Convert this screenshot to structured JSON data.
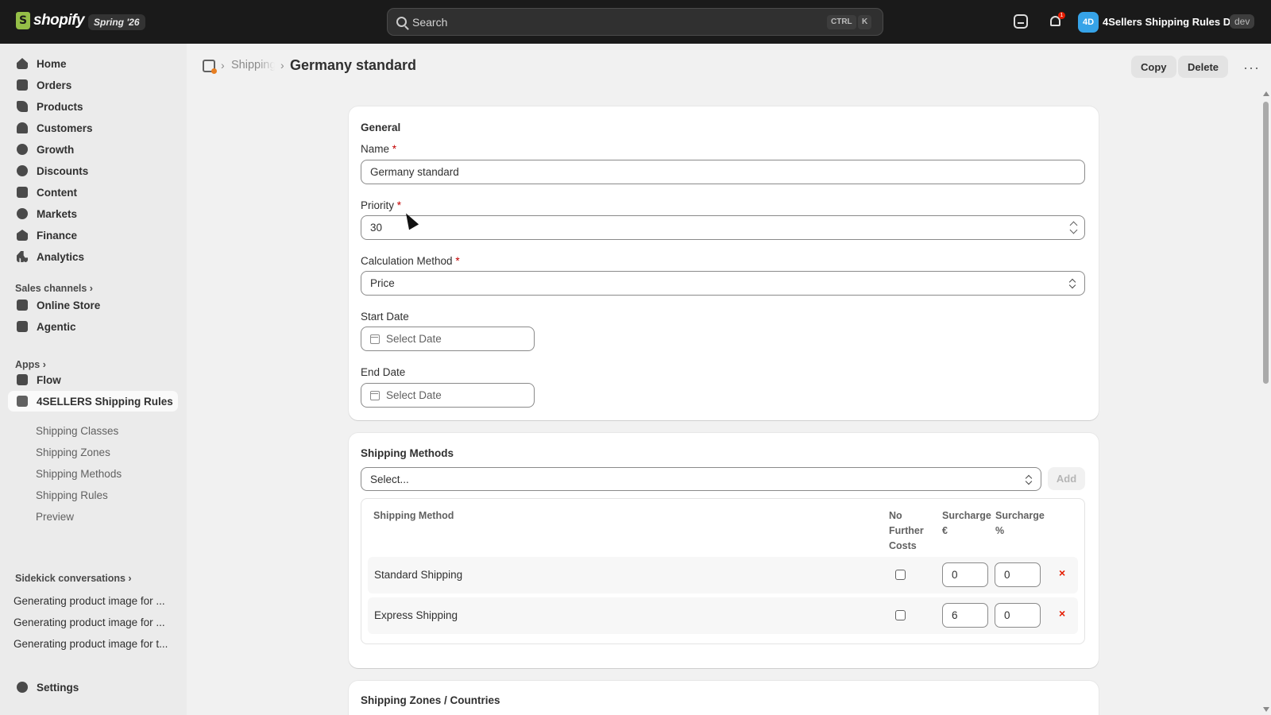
{
  "topbar": {
    "brand": "shopify",
    "edition_badge": "Spring '26",
    "search_placeholder": "Search",
    "kbd_ctrl": "CTRL",
    "kbd_k": "K",
    "notification_count": "1",
    "store_avatar": "4D",
    "store_name": "4Sellers Shipping Rules D...",
    "env_badge": "dev",
    "icons": [
      "search-icon",
      "chat-icon",
      "bell-icon"
    ]
  },
  "sidebar": {
    "nav": [
      {
        "label": "Home",
        "icon": "home-icon"
      },
      {
        "label": "Orders",
        "icon": "orders-icon"
      },
      {
        "label": "Products",
        "icon": "tag-icon"
      },
      {
        "label": "Customers",
        "icon": "person-icon"
      },
      {
        "label": "Growth",
        "icon": "growth-icon"
      },
      {
        "label": "Discounts",
        "icon": "discount-icon"
      },
      {
        "label": "Content",
        "icon": "content-icon"
      },
      {
        "label": "Markets",
        "icon": "globe-icon"
      },
      {
        "label": "Finance",
        "icon": "bank-icon"
      },
      {
        "label": "Analytics",
        "icon": "bar-chart-icon"
      }
    ],
    "sales_channels_label": "Sales channels",
    "sales_channels": [
      {
        "label": "Online Store",
        "icon": "store-icon"
      },
      {
        "label": "Agentic",
        "icon": "agentic-icon"
      }
    ],
    "apps_label": "Apps",
    "apps": [
      {
        "label": "Flow",
        "icon": "flow-icon"
      },
      {
        "label": "4SELLERS Shipping Rules",
        "icon": "app-icon"
      }
    ],
    "app_subitems": [
      "Shipping Classes",
      "Shipping Zones",
      "Shipping Methods",
      "Shipping Rules",
      "Preview"
    ],
    "sidekick_label": "Sidekick conversations",
    "sidekick_items": [
      "Generating product image for ...",
      "Generating product image for ...",
      "Generating product image for t..."
    ],
    "settings_label": "Settings"
  },
  "header": {
    "breadcrumb_parent": "Shipping",
    "title": "Germany standard",
    "copy_label": "Copy",
    "delete_label": "Delete",
    "more_label": "···"
  },
  "general": {
    "title": "General",
    "name_label": "Name",
    "name_value": "Germany standard",
    "priority_label": "Priority",
    "priority_value": "30",
    "calc_label": "Calculation Method",
    "calc_value": "Price",
    "start_label": "Start Date",
    "start_placeholder": "Select Date",
    "end_label": "End Date",
    "end_placeholder": "Select Date",
    "required_mark": "*"
  },
  "methods": {
    "title": "Shipping Methods",
    "select_placeholder": "Select...",
    "add_label": "Add",
    "col_method": "Shipping Method",
    "col_no_further": "No Further Costs",
    "col_surcharge_eur": "Surcharge €",
    "col_surcharge_pct": "Surcharge %",
    "rows": [
      {
        "name": "Standard Shipping",
        "no_further": false,
        "surcharge_eur": "0",
        "surcharge_pct": "0"
      },
      {
        "name": "Express Shipping",
        "no_further": false,
        "surcharge_eur": "6",
        "surcharge_pct": "0"
      }
    ],
    "remove_glyph": "×"
  },
  "zones": {
    "title": "Shipping Zones / Countries"
  }
}
